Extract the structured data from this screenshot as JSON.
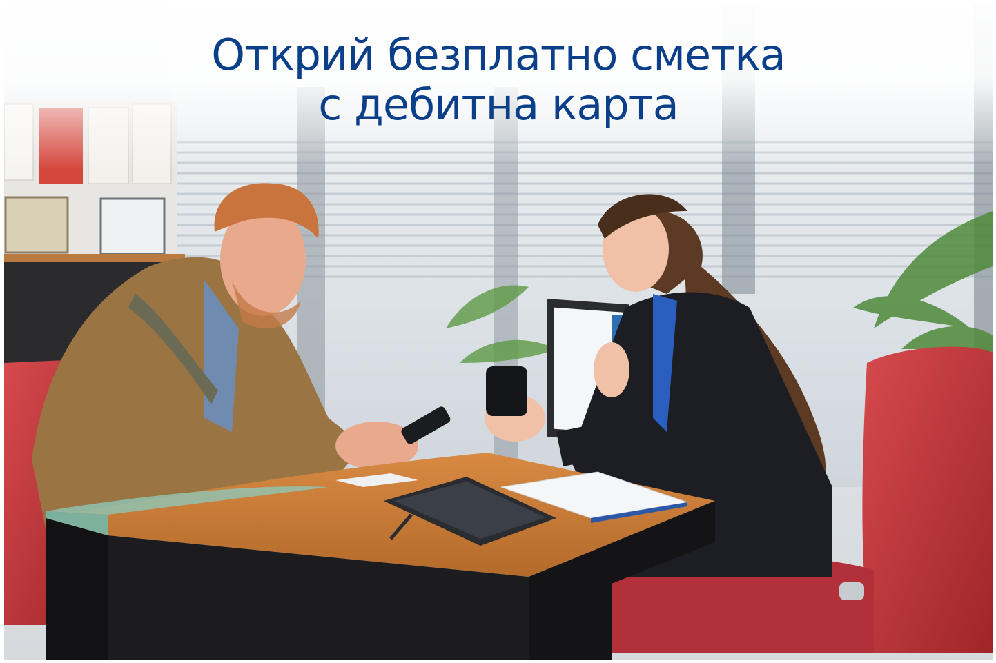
{
  "banner": {
    "headline_line1": "Открий безплатно сметка",
    "headline_line2": "с дебитна карта"
  },
  "photo": {
    "subject": "bank-branch-consultation",
    "colors": {
      "headline": "#0b3f8a",
      "desk_top": "#c87a35",
      "chair": "#c2353b",
      "jacket_left": "#9a7443",
      "blazer_right": "#1d1e24"
    }
  }
}
